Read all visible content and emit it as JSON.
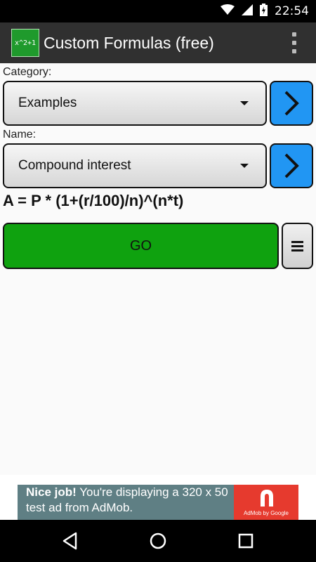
{
  "status_bar": {
    "time": "22:54",
    "icons": [
      "wifi-icon",
      "signal-icon",
      "battery-charging-icon"
    ]
  },
  "action_bar": {
    "app_icon_text": "x^2+1",
    "title": "Custom Formulas (free)",
    "overflow_icon": "overflow-menu-icon"
  },
  "category": {
    "label": "Category:",
    "selected": "Examples"
  },
  "name": {
    "label": "Name:",
    "selected": "Compound interest"
  },
  "formula": "A = P * (1+(r/100)/n)^(n*t)",
  "go_button": "GO",
  "ad": {
    "bold": "Nice job!",
    "text": " You're displaying a 320 x 50 test ad from AdMob.",
    "brand": "AdMob by Google"
  },
  "colors": {
    "go_green": "#0fa20f",
    "next_blue": "#2196f3",
    "action_bar": "#303030",
    "admob_red": "#e63a2e",
    "ad_bg": "#5f7f84"
  }
}
